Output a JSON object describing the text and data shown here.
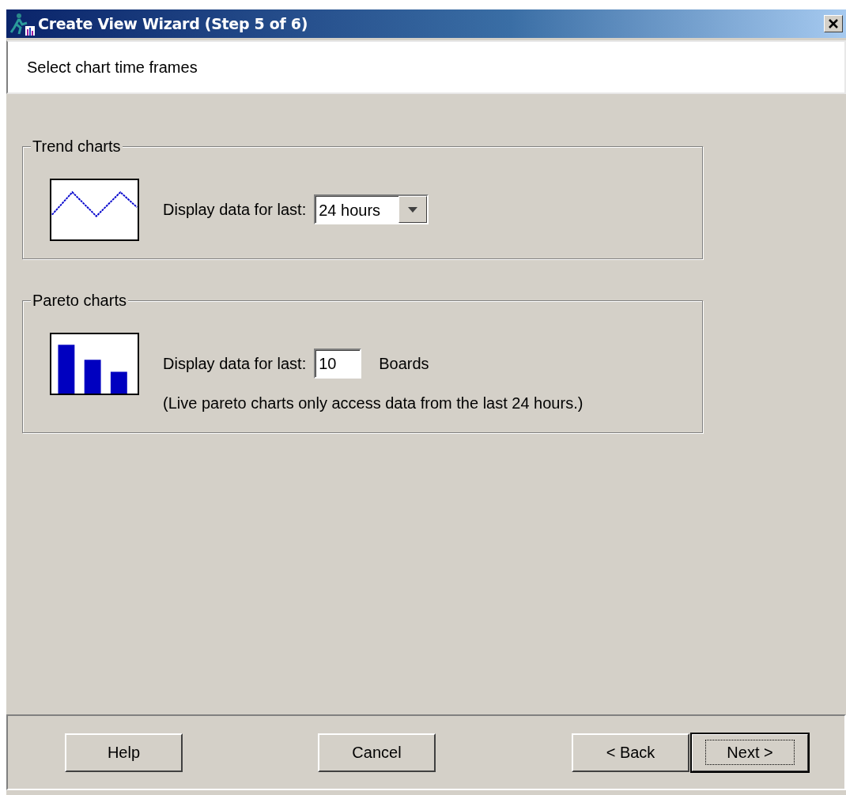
{
  "window": {
    "title": "Create View Wizard (Step 5 of 6)"
  },
  "header": {
    "text": "Select chart time frames"
  },
  "groups": [
    {
      "kind": "trend",
      "title": "Trend charts",
      "label": "Display data for last:",
      "control": {
        "kind": "combo",
        "value": "24 hours"
      }
    },
    {
      "kind": "pareto",
      "title": "Pareto charts",
      "label": "Display data for last:",
      "control": {
        "kind": "input",
        "value": "10",
        "unit": "Boards"
      },
      "note": "(Live pareto charts only access data from the last 24 hours.)"
    }
  ],
  "buttons": [
    {
      "label": "Help",
      "default": false
    },
    {
      "label": "Cancel",
      "default": false
    },
    {
      "label": "< Back",
      "default": false
    },
    {
      "label": "Next >",
      "default": true
    }
  ]
}
